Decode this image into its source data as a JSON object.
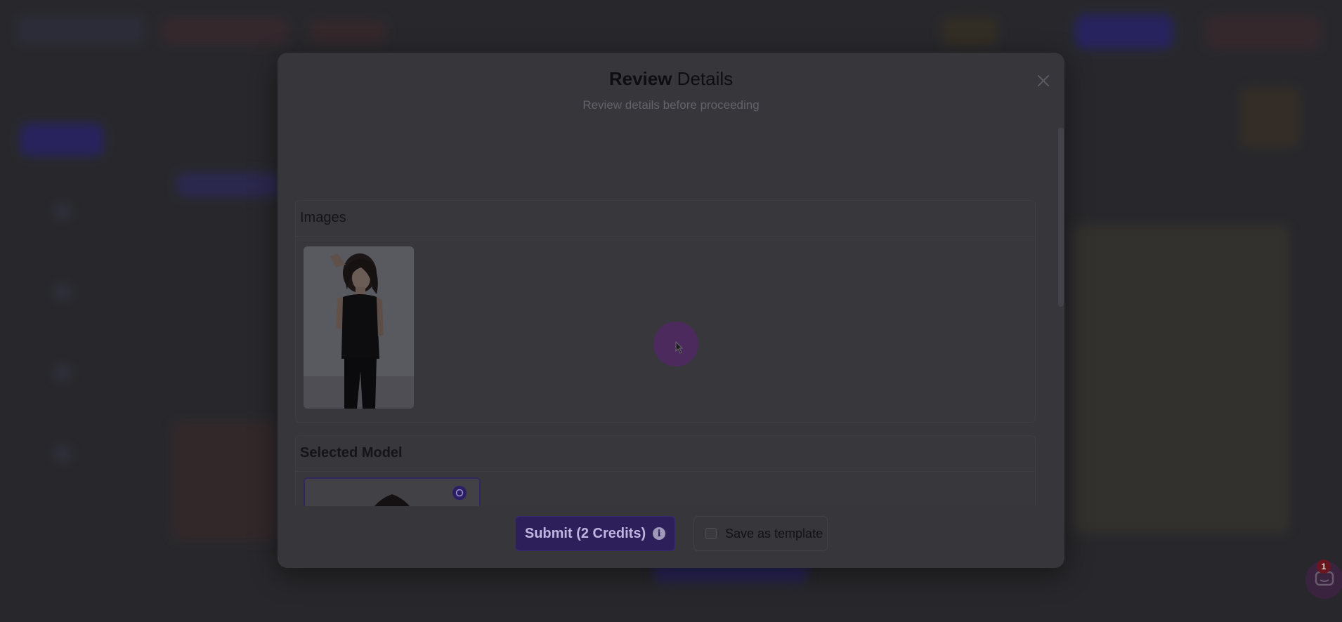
{
  "modal": {
    "title_strong": "Review",
    "title_rest": "Details",
    "subtitle": "Review details before proceeding",
    "close_icon": "close-icon"
  },
  "sections": {
    "images_title": "Images",
    "model_title": "Selected Model"
  },
  "footer": {
    "submit_label": "Submit (2 Credits)",
    "info_glyph": "i",
    "template_label": "Save as template"
  },
  "chat": {
    "badge_count": "1"
  },
  "colors": {
    "accent": "#2d1f5a",
    "overlay": "#2a2a2d",
    "badge": "#6a1620"
  }
}
